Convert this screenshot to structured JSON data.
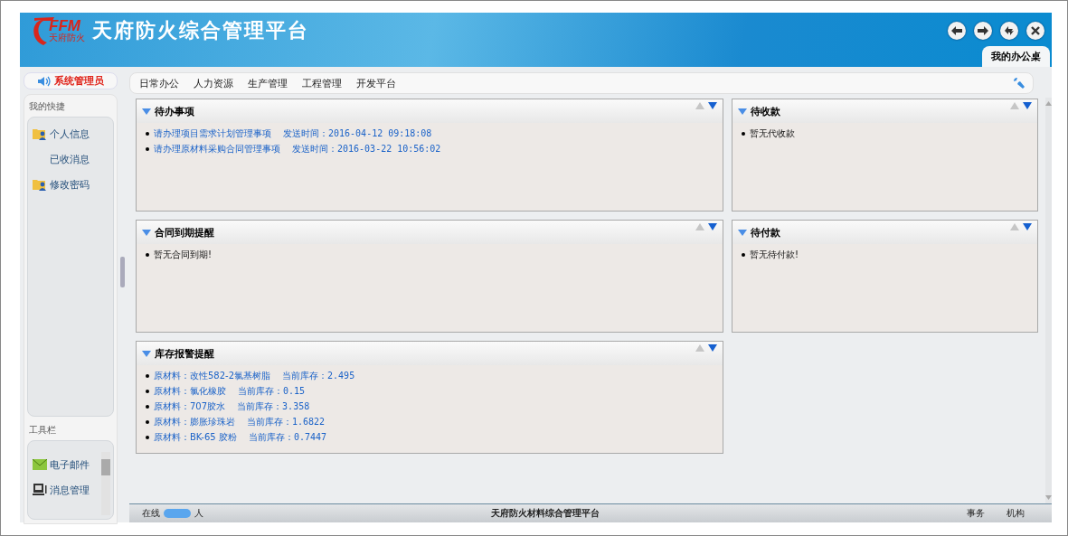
{
  "header": {
    "logo_text": "FFM",
    "logo_subtext": "天府防火",
    "title": "天府防火综合管理平台",
    "tab": "我的办公桌"
  },
  "user": {
    "name": "系统管理员"
  },
  "menu": {
    "items": [
      "日常办公",
      "人力资源",
      "生产管理",
      "工程管理",
      "开发平台"
    ]
  },
  "sidebar": {
    "shortcuts_label": "我的快捷",
    "shortcuts": [
      {
        "label": "个人信息",
        "icon": true
      },
      {
        "label": "已收消息",
        "icon": false
      },
      {
        "label": "修改密码",
        "icon": true
      }
    ],
    "tools_label": "工具栏",
    "tools": [
      {
        "label": "电子邮件",
        "kind": "mail"
      },
      {
        "label": "消息管理",
        "kind": "monitor"
      }
    ]
  },
  "portlets": [
    {
      "title": "待办事项",
      "items": [
        {
          "kind": "link",
          "text": "请办理项目需求计划管理事项",
          "detail": "发送时间：2016-04-12 09:18:08"
        },
        {
          "kind": "link",
          "text": "请办理原材料采购合同管理事项",
          "detail": "发送时间：2016-03-22 10:56:02"
        }
      ]
    },
    {
      "title": "待收款",
      "items": [
        {
          "kind": "text",
          "text": "暂无代收款"
        }
      ]
    },
    {
      "title": "合同到期提醒",
      "items": [
        {
          "kind": "text",
          "text": "暂无合同到期!"
        }
      ]
    },
    {
      "title": "待付款",
      "items": [
        {
          "kind": "text",
          "text": "暂无待付款!"
        }
      ]
    },
    {
      "title": "库存报警提醒",
      "items": [
        {
          "kind": "link",
          "text": "原材料：改性582-2氯基树脂",
          "detail": "当前库存：2.495"
        },
        {
          "kind": "link",
          "text": "原材料：氯化橡胶",
          "detail": "当前库存：0.15"
        },
        {
          "kind": "link",
          "text": "原材料：707胶水",
          "detail": "当前库存：3.358"
        },
        {
          "kind": "link",
          "text": "原材料：膨胀珍珠岩",
          "detail": "当前库存：1.6822"
        },
        {
          "kind": "link",
          "text": "原材料：BK-65 胶粉",
          "detail": "当前库存：0.7447"
        }
      ]
    }
  ],
  "status_bar": {
    "online_label": "在线",
    "online_unit": "人",
    "center": "天府防火材料综合管理平台",
    "links": [
      "事务",
      "机构"
    ]
  }
}
